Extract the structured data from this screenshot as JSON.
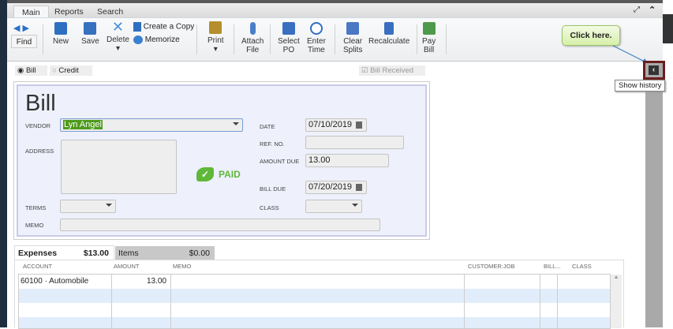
{
  "ribbon_tabs": [
    "Main",
    "Reports",
    "Search"
  ],
  "toolbar": {
    "find": "Find",
    "new": "New",
    "save": "Save",
    "delete": "Delete",
    "create_copy": "Create a Copy",
    "memorize": "Memorize",
    "print": "Print",
    "attach_1": "Attach",
    "attach_2": "File",
    "select_1": "Select",
    "select_2": "PO",
    "enter_1": "Enter",
    "enter_2": "Time",
    "clear_1": "Clear",
    "clear_2": "Splits",
    "recalculate": "Recalculate",
    "pay_1": "Pay",
    "pay_2": "Bill"
  },
  "callout": "Click here.",
  "tooltip": "Show history",
  "type_options": {
    "bill": "Bill",
    "credit": "Credit",
    "bill_received": "Bill Received"
  },
  "form": {
    "title": "Bill",
    "vendor_label": "VENDOR",
    "vendor": "Lyn Angel",
    "address_label": "ADDRESS",
    "terms_label": "TERMS",
    "memo_label": "MEMO",
    "date_label": "DATE",
    "date": "07/10/2019",
    "ref_label": "REF. NO.",
    "amount_due_label": "AMOUNT DUE",
    "amount_due": "13.00",
    "bill_due_label": "BILL DUE",
    "bill_due": "07/20/2019",
    "class_label": "CLASS",
    "paid": "PAID"
  },
  "detail_tabs": [
    {
      "label": "Expenses",
      "amount": "$13.00"
    },
    {
      "label": "Items",
      "amount": "$0.00"
    }
  ],
  "grid": {
    "headers": [
      "ACCOUNT",
      "AMOUNT",
      "MEMO",
      "CUSTOMER:JOB",
      "BILL...",
      "CLASS"
    ],
    "rows": [
      {
        "account": "60100 · Automobile",
        "amount": "13.00"
      }
    ]
  }
}
